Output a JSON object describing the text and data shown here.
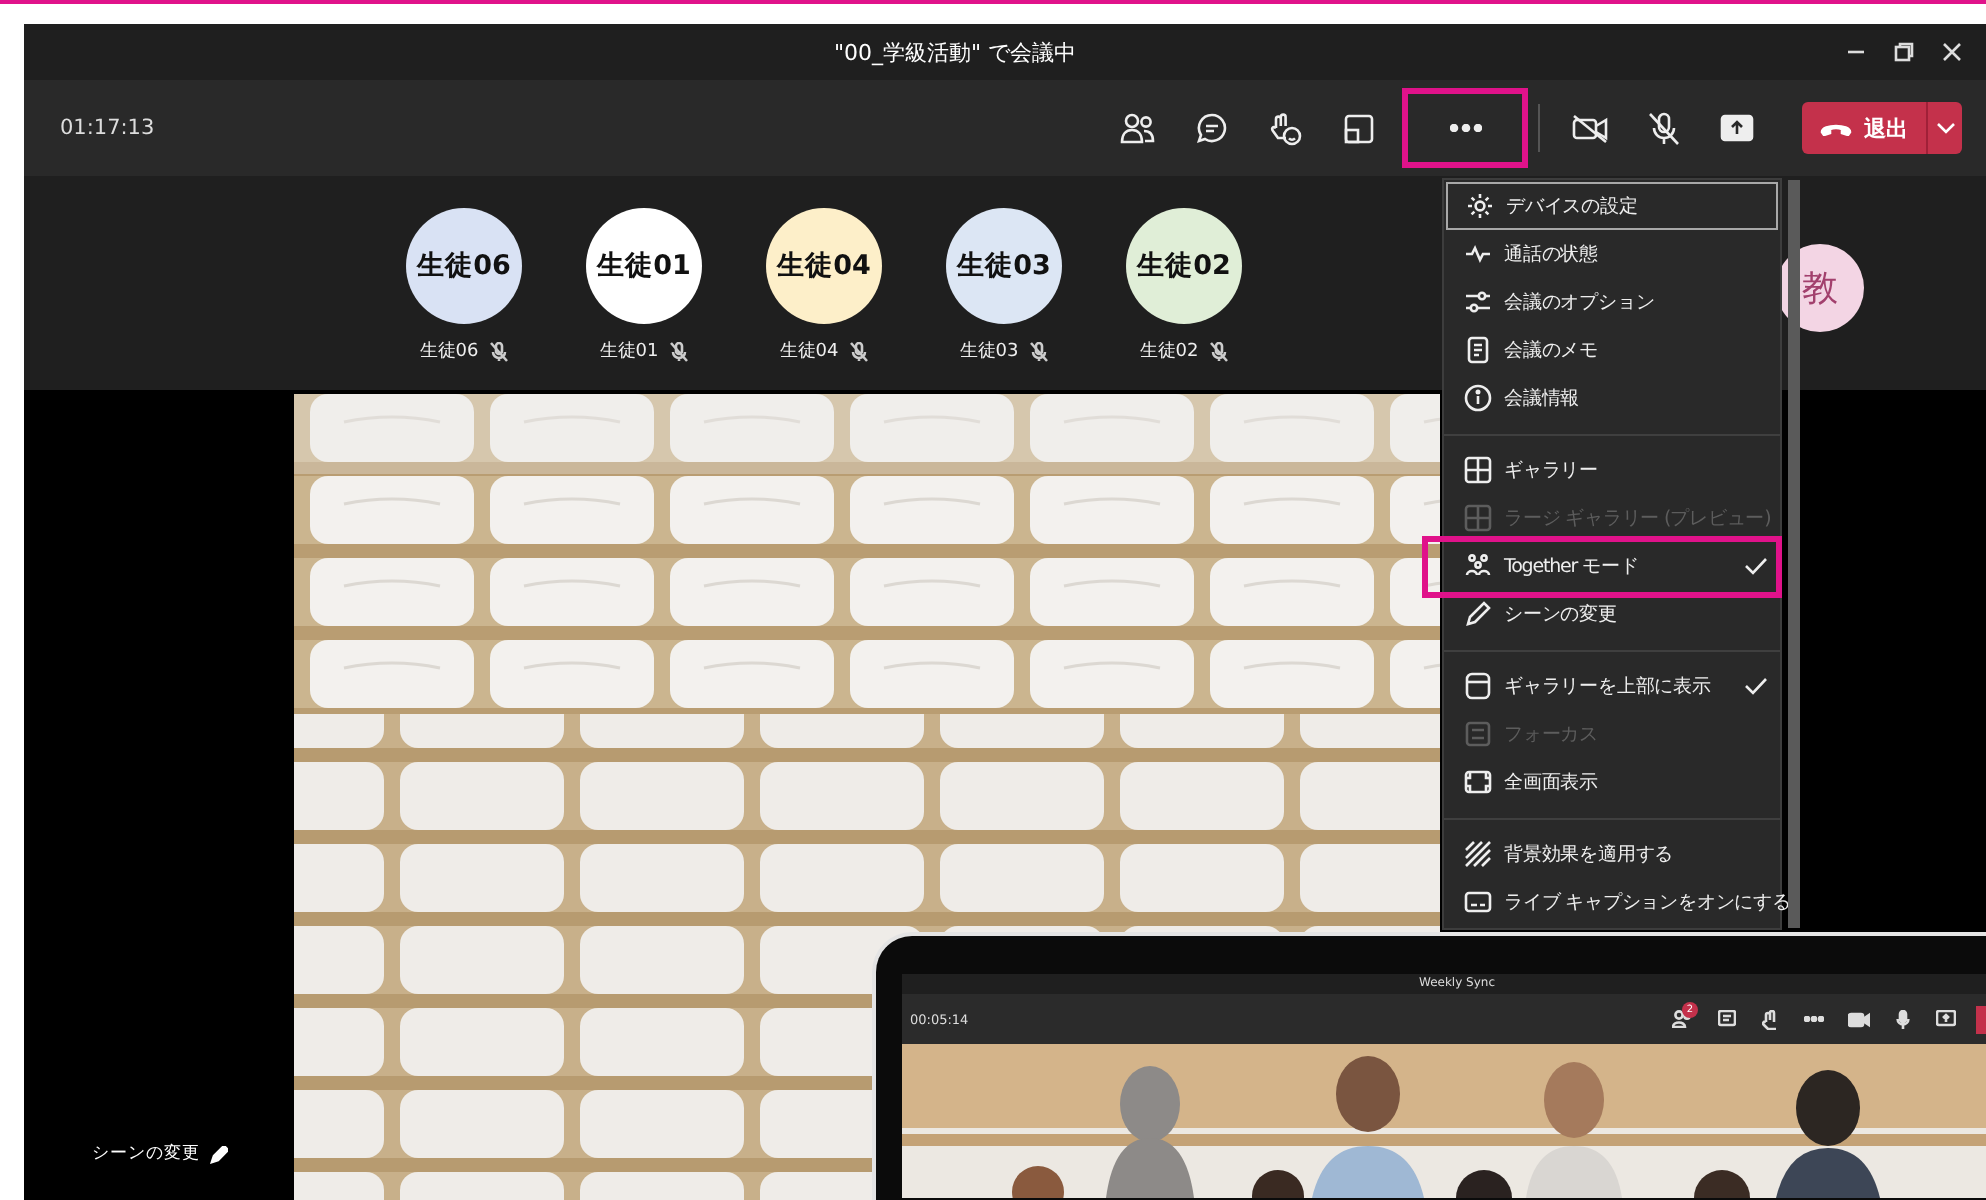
{
  "window": {
    "title": "\"00_学級活動\" で会議中"
  },
  "toolbar": {
    "timer": "01:17:13",
    "more_highlighted": true,
    "leave_button": "退出"
  },
  "participants": [
    {
      "avatar_text": "生徒06",
      "name": "生徒06",
      "color": "#d9e2f4",
      "muted": true
    },
    {
      "avatar_text": "生徒01",
      "name": "生徒01",
      "color": "#ffffff",
      "muted": true
    },
    {
      "avatar_text": "生徒04",
      "name": "生徒04",
      "color": "#fdefc9",
      "muted": true
    },
    {
      "avatar_text": "生徒03",
      "name": "生徒03",
      "color": "#dce6f4",
      "muted": true
    },
    {
      "avatar_text": "生徒02",
      "name": "生徒02",
      "color": "#e0eed7",
      "muted": true
    }
  ],
  "teacher": {
    "avatar_text": "教",
    "color": "#f3d5e4"
  },
  "menu": {
    "items": [
      {
        "kind": "item",
        "label": "デバイスの設定",
        "focused": true,
        "disabled": false,
        "checked": false,
        "highlighted": false
      },
      {
        "kind": "item",
        "label": "通話の状態",
        "focused": false,
        "disabled": false,
        "checked": false,
        "highlighted": false
      },
      {
        "kind": "item",
        "label": "会議のオプション",
        "focused": false,
        "disabled": false,
        "checked": false,
        "highlighted": false
      },
      {
        "kind": "item",
        "label": "会議のメモ",
        "focused": false,
        "disabled": false,
        "checked": false,
        "highlighted": false
      },
      {
        "kind": "item",
        "label": "会議情報",
        "focused": false,
        "disabled": false,
        "checked": false,
        "highlighted": false
      },
      {
        "kind": "divider"
      },
      {
        "kind": "item",
        "label": "ギャラリー",
        "focused": false,
        "disabled": false,
        "checked": false,
        "highlighted": false
      },
      {
        "kind": "item",
        "label": "ラージ ギャラリー (プレビュー)",
        "focused": false,
        "disabled": true,
        "checked": false,
        "highlighted": false
      },
      {
        "kind": "item",
        "label": "Together モード",
        "focused": false,
        "disabled": false,
        "checked": true,
        "highlighted": true
      },
      {
        "kind": "item",
        "label": "シーンの変更",
        "focused": false,
        "disabled": false,
        "checked": false,
        "highlighted": false
      },
      {
        "kind": "divider"
      },
      {
        "kind": "item",
        "label": "ギャラリーを上部に表示",
        "focused": false,
        "disabled": false,
        "checked": true,
        "highlighted": false
      },
      {
        "kind": "item",
        "label": "フォーカス",
        "focused": false,
        "disabled": true,
        "checked": false,
        "highlighted": false
      },
      {
        "kind": "item",
        "label": "全画面表示",
        "focused": false,
        "disabled": false,
        "checked": false,
        "highlighted": false
      },
      {
        "kind": "divider"
      },
      {
        "kind": "item",
        "label": "背景効果を適用する",
        "focused": false,
        "disabled": false,
        "checked": false,
        "highlighted": false
      },
      {
        "kind": "item",
        "label": "ライブ キャプションをオンにする",
        "focused": false,
        "disabled": false,
        "checked": false,
        "highlighted": false
      }
    ]
  },
  "stage": {
    "scene_button": "シーンの変更"
  },
  "inset": {
    "title": "Weekly Sync",
    "timer": "00:05:14",
    "badge": "2"
  }
}
